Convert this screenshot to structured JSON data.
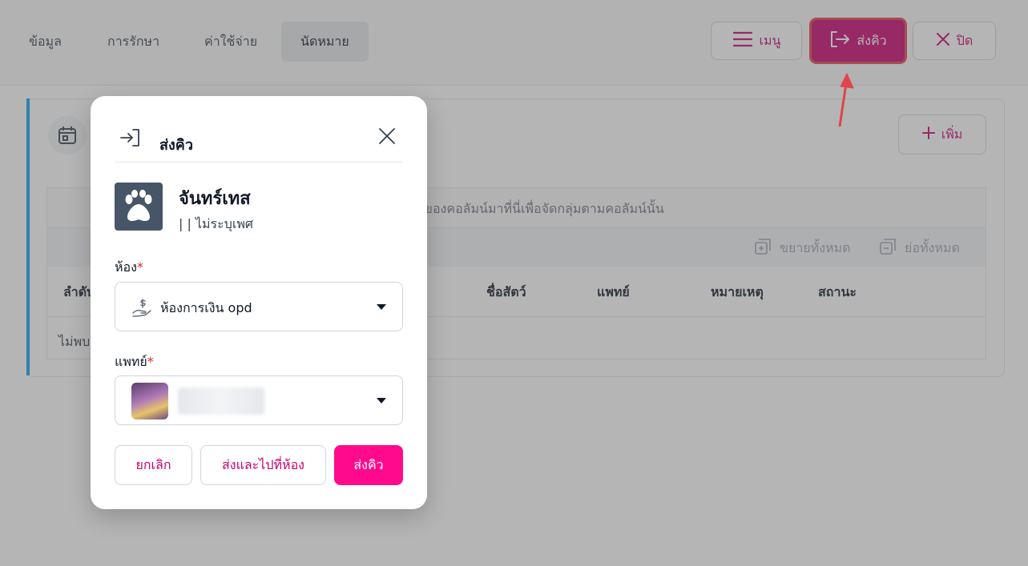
{
  "tabs": [
    {
      "label": "ข้อมูล"
    },
    {
      "label": "การรักษา"
    },
    {
      "label": "ค่าใช้จ่าย"
    },
    {
      "label": "นัดหมาย"
    }
  ],
  "header_buttons": {
    "menu_label": "เมนู",
    "queue_label": "ส่งคิว",
    "close_label": "ปิด"
  },
  "content": {
    "add_label": "เพิ่ม",
    "group_hint": "ของคอลัมน์มาที่นี่เพื่อจัดกลุ่มตามคอลัมน์นั้น",
    "expand_all": "ขยายทั้งหมด",
    "collapse_all": "ย่อทั้งหมด",
    "columns": [
      "ลำดับ",
      "ชื่อสัตว์",
      "แพทย์",
      "หมายเหตุ",
      "สถานะ"
    ],
    "empty_text": "ไม่พบ"
  },
  "modal": {
    "title": "ส่งคิว",
    "pet_name": "จันทร์เทส",
    "pet_sub": "| | ไม่ระบุเพศ",
    "room_label": "ห้อง",
    "room_value": "ห้องการเงิน opd",
    "doctor_label": "แพทย์",
    "required_mark": "*",
    "cancel_label": "ยกเลิก",
    "send_go_label": "ส่งและไปที่ห้อง",
    "send_label": "ส่งคิว"
  },
  "colors": {
    "brand": "#c8006f",
    "primary_button": "#ff0a8c",
    "accent": "#0ea5e9",
    "annotation": "#e0454a"
  }
}
